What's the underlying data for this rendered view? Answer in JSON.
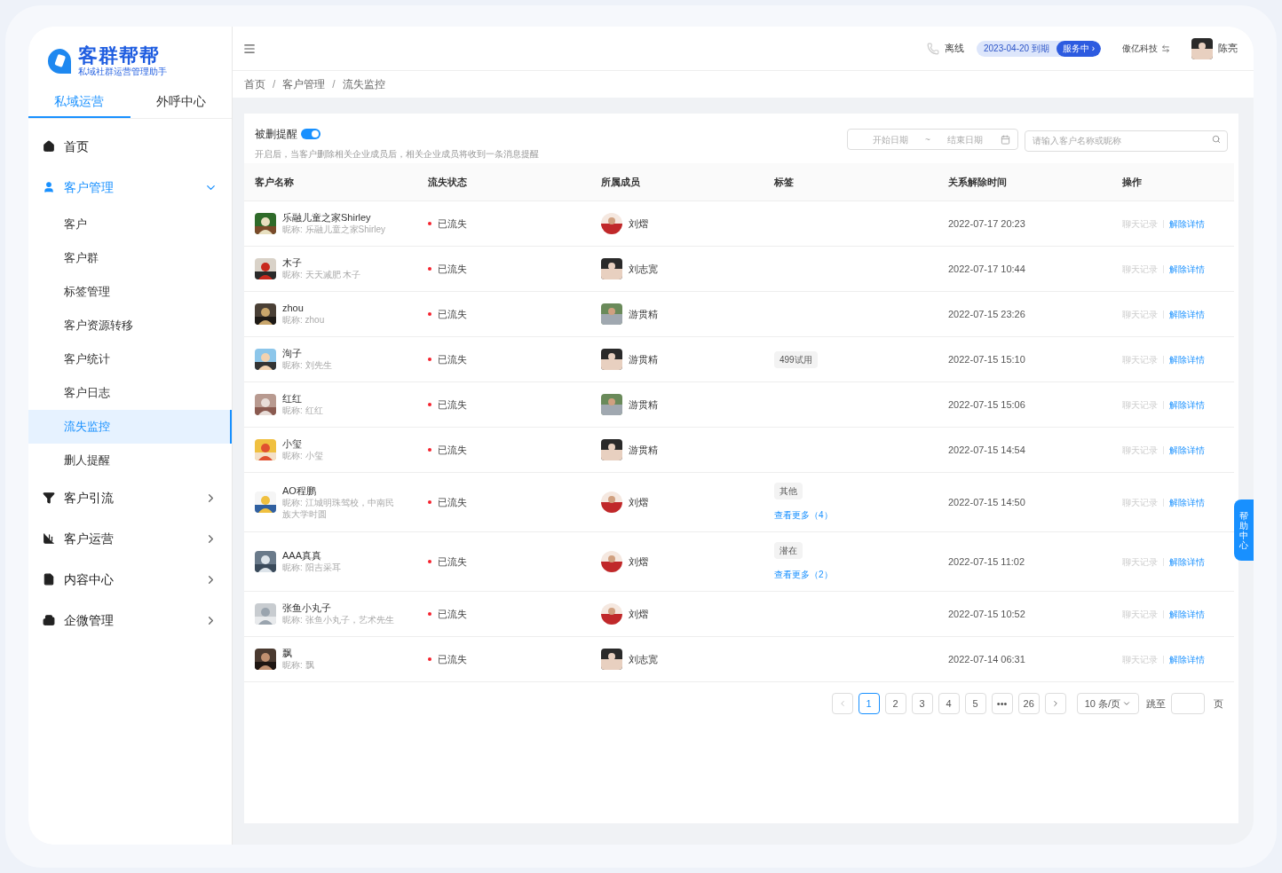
{
  "logo": {
    "title": "客群帮帮",
    "subtitle": "私域社群运营管理助手"
  },
  "sidebar": {
    "tabs": [
      {
        "label": "私域运营",
        "selected": true
      },
      {
        "label": "外呼中心",
        "selected": false
      }
    ],
    "items": [
      {
        "label": "首页",
        "expanded": false,
        "selected": false
      },
      {
        "label": "客户管理",
        "expanded": true,
        "selected": true,
        "children": [
          {
            "label": "客户",
            "selected": false
          },
          {
            "label": "客户群",
            "selected": false
          },
          {
            "label": "标签管理",
            "selected": false
          },
          {
            "label": "客户资源转移",
            "selected": false
          },
          {
            "label": "客户统计",
            "selected": false
          },
          {
            "label": "客户日志",
            "selected": false
          },
          {
            "label": "流失监控",
            "selected": true
          },
          {
            "label": "删人提醒",
            "selected": false
          }
        ]
      },
      {
        "label": "客户引流",
        "expanded": false,
        "selected": false
      },
      {
        "label": "客户运营",
        "expanded": false,
        "selected": false
      },
      {
        "label": "内容中心",
        "expanded": false,
        "selected": false
      },
      {
        "label": "企微管理",
        "expanded": false,
        "selected": false
      }
    ]
  },
  "header": {
    "phone_status": "离线",
    "expiry": "2023-04-20 到期",
    "service": "服务中 ›",
    "company": "傲亿科技",
    "user": "陈亮"
  },
  "breadcrumb": {
    "separator": "/",
    "items": [
      "首页",
      "客户管理",
      "流失监控"
    ]
  },
  "notice": {
    "title": "被删提醒",
    "on": true,
    "description": "开启后，当客户删除相关企业成员后，相关企业成员将收到一条消息提醒"
  },
  "filters": {
    "start_placeholder": "开始日期",
    "separator": "~",
    "end_placeholder": "结束日期",
    "search_placeholder": "请输入客户名称或昵称"
  },
  "table": {
    "columns": [
      "客户名称",
      "流失状态",
      "所属成员",
      "标签",
      "关系解除时间",
      "操作"
    ],
    "rows": [
      {
        "name": "乐融儿童之家Shirley",
        "nickname": "昵称: 乐融儿童之家Shirley",
        "status": "已流失",
        "member": "刘熠",
        "tags": [],
        "time": "2022-07-17 20:23",
        "actions": [
          {
            "label": "聊天记录",
            "disabled": true
          },
          {
            "label": "解除详情",
            "disabled": false
          }
        ]
      },
      {
        "name": "木子",
        "nickname": "昵称: 天天减肥 木子",
        "status": "已流失",
        "member": "刘志宽",
        "tags": [],
        "time": "2022-07-17 10:44",
        "actions": [
          {
            "label": "聊天记录",
            "disabled": true
          },
          {
            "label": "解除详情",
            "disabled": false
          }
        ]
      },
      {
        "name": "zhou",
        "nickname": "昵称: zhou",
        "status": "已流失",
        "member": "游贯精",
        "tags": [],
        "time": "2022-07-15 23:26",
        "actions": [
          {
            "label": "聊天记录",
            "disabled": true
          },
          {
            "label": "解除详情",
            "disabled": false
          }
        ]
      },
      {
        "name": "洵子",
        "nickname": "昵称: 刘先生",
        "status": "已流失",
        "member": "游贯精",
        "tags": [
          "499试用"
        ],
        "time": "2022-07-15 15:10",
        "actions": [
          {
            "label": "聊天记录",
            "disabled": true
          },
          {
            "label": "解除详情",
            "disabled": false
          }
        ]
      },
      {
        "name": "红红",
        "nickname": "昵称: 红红",
        "status": "已流失",
        "member": "游贯精",
        "tags": [],
        "time": "2022-07-15 15:06",
        "actions": [
          {
            "label": "聊天记录",
            "disabled": true
          },
          {
            "label": "解除详情",
            "disabled": false
          }
        ]
      },
      {
        "name": "小玺",
        "nickname": "昵称: 小玺",
        "status": "已流失",
        "member": "游贯精",
        "tags": [],
        "time": "2022-07-15 14:54",
        "actions": [
          {
            "label": "聊天记录",
            "disabled": true
          },
          {
            "label": "解除详情",
            "disabled": false
          }
        ]
      },
      {
        "name": "AO程鹏",
        "nickname": "昵称: 江城明珠驾校，中南民族大学时圆",
        "status": "已流失",
        "member": "刘熠",
        "tags": [
          "其他"
        ],
        "more": "查看更多（4）",
        "time": "2022-07-15 14:50",
        "actions": [
          {
            "label": "聊天记录",
            "disabled": true
          },
          {
            "label": "解除详情",
            "disabled": false
          }
        ]
      },
      {
        "name": "AAA真真",
        "nickname": "昵称: 阳吉采耳",
        "status": "已流失",
        "member": "刘熠",
        "tags": [
          "潜在"
        ],
        "more": "查看更多（2）",
        "time": "2022-07-15 11:02",
        "actions": [
          {
            "label": "聊天记录",
            "disabled": true
          },
          {
            "label": "解除详情",
            "disabled": false
          }
        ]
      },
      {
        "name": "张鱼小丸子",
        "nickname": "昵称: 张鱼小丸子，艺术先生",
        "status": "已流失",
        "member": "刘熠",
        "tags": [],
        "time": "2022-07-15 10:52",
        "actions": [
          {
            "label": "聊天记录",
            "disabled": true
          },
          {
            "label": "解除详情",
            "disabled": false
          }
        ]
      },
      {
        "name": "飘",
        "nickname": "昵称: 飘",
        "status": "已流失",
        "member": "刘志宽",
        "tags": [],
        "time": "2022-07-14 06:31",
        "actions": [
          {
            "label": "聊天记录",
            "disabled": true
          },
          {
            "label": "解除详情",
            "disabled": false
          }
        ]
      }
    ]
  },
  "pagination": {
    "pages": [
      {
        "label": "1",
        "selected": true
      },
      {
        "label": "2",
        "selected": false
      },
      {
        "label": "3",
        "selected": false
      },
      {
        "label": "4",
        "selected": false
      },
      {
        "label": "5",
        "selected": false
      },
      {
        "label": "•••",
        "selected": false
      },
      {
        "label": "26",
        "selected": false
      }
    ],
    "page_size": "10 条/页",
    "jump_label": "跳至",
    "page_unit": "页"
  },
  "help": "帮助中心"
}
